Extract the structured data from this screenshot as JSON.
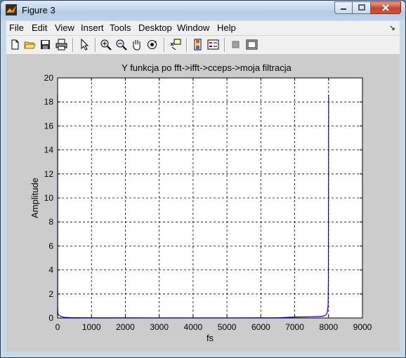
{
  "window": {
    "title": "Figure 3"
  },
  "menu": [
    "File",
    "Edit",
    "View",
    "Insert",
    "Tools",
    "Desktop",
    "Window",
    "Help"
  ],
  "toolbar": {
    "buttons": [
      "new-figure",
      "open-file",
      "save",
      "print",
      "edit-plot",
      "zoom-in",
      "zoom-out",
      "pan",
      "rotate-3d",
      "data-cursor",
      "colorbar",
      "legend",
      "hide-plot-tools",
      "show-plot-tools"
    ]
  },
  "chart_data": {
    "type": "line",
    "title": "Y funkcja po fft->ifft->cceps->moja filtracja",
    "xlabel": "fs",
    "ylabel": "Amplitude",
    "xlim": [
      0,
      9000
    ],
    "ylim": [
      0,
      20
    ],
    "xticks": [
      0,
      1000,
      2000,
      3000,
      4000,
      5000,
      6000,
      7000,
      8000,
      9000
    ],
    "yticks": [
      0,
      2,
      4,
      6,
      8,
      10,
      12,
      14,
      16,
      18,
      20
    ],
    "grid": true,
    "series": [
      {
        "color": "#0000ff",
        "x": [
          0,
          3,
          8,
          15,
          30,
          60,
          100,
          150,
          200,
          400,
          800,
          1500,
          3000,
          5000,
          6500,
          7000,
          7400,
          7700,
          7850,
          7920,
          7960,
          7985,
          7995,
          8000
        ],
        "y": [
          18.6,
          1.0,
          0.45,
          0.35,
          0.25,
          0.2,
          0.12,
          0.08,
          0.05,
          0.03,
          0.02,
          0.015,
          0.01,
          0.01,
          0.02,
          0.08,
          0.1,
          0.12,
          0.15,
          0.25,
          0.4,
          1.0,
          3.0,
          18.6
        ]
      }
    ]
  }
}
